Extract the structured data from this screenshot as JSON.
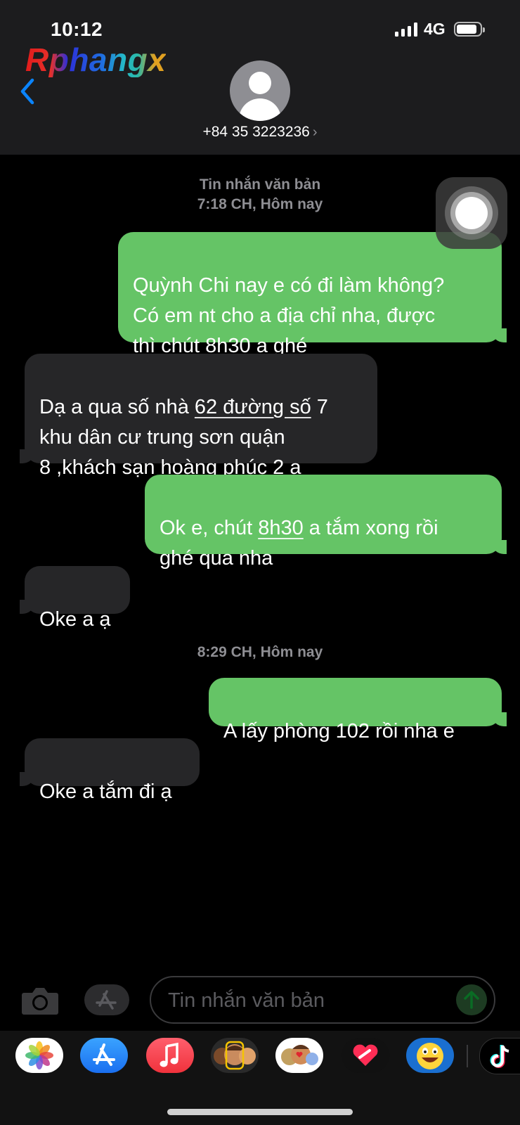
{
  "status_bar": {
    "time": "10:12",
    "network": "4G"
  },
  "watermark": "Rphangx",
  "contact": {
    "name": "+84 35 3223236",
    "chevron": "›"
  },
  "conversation": {
    "meta1": {
      "type": "Tin nhắn văn bản",
      "time": "7:18 CH, Hôm nay"
    },
    "meta2": {
      "time": "8:29 CH, Hôm nay"
    },
    "messages": [
      {
        "direction": "sent",
        "parts": [
          "Quỳnh Chi nay e có đi làm không?\nCó em nt cho a địa chỉ nha, được\nthì chút ",
          "8h30",
          " a ghé"
        ]
      },
      {
        "direction": "received",
        "parts": [
          "Dạ a qua số nhà ",
          "62 đường số",
          " 7\nkhu dân cư trung sơn quận\n8 ,khách sạn hoàng phúc 2 ạ"
        ]
      },
      {
        "direction": "sent",
        "parts": [
          "Ok e, chút ",
          "8h30",
          " a tắm xong rồi\nghé qua nha"
        ]
      },
      {
        "direction": "received",
        "parts": [
          "Oke a ạ"
        ]
      },
      {
        "direction": "sent",
        "parts": [
          "A lấy phòng 102 rồi nha e"
        ]
      },
      {
        "direction": "received",
        "parts": [
          "Oke a tắm đi ạ"
        ]
      }
    ]
  },
  "composer": {
    "placeholder": "Tin nhắn văn bản"
  },
  "app_drawer": {
    "apps": [
      "photos-icon",
      "app-store-icon",
      "music-icon",
      "memoji-icon",
      "animoji-icon",
      "digital-touch-icon",
      "emoji-sticker-icon",
      "tiktok-icon"
    ]
  },
  "colors": {
    "sent_bubble": "#65c466",
    "received_bubble": "#262628",
    "header_bg": "#1c1c1e",
    "link_blue": "#0a84ff"
  }
}
